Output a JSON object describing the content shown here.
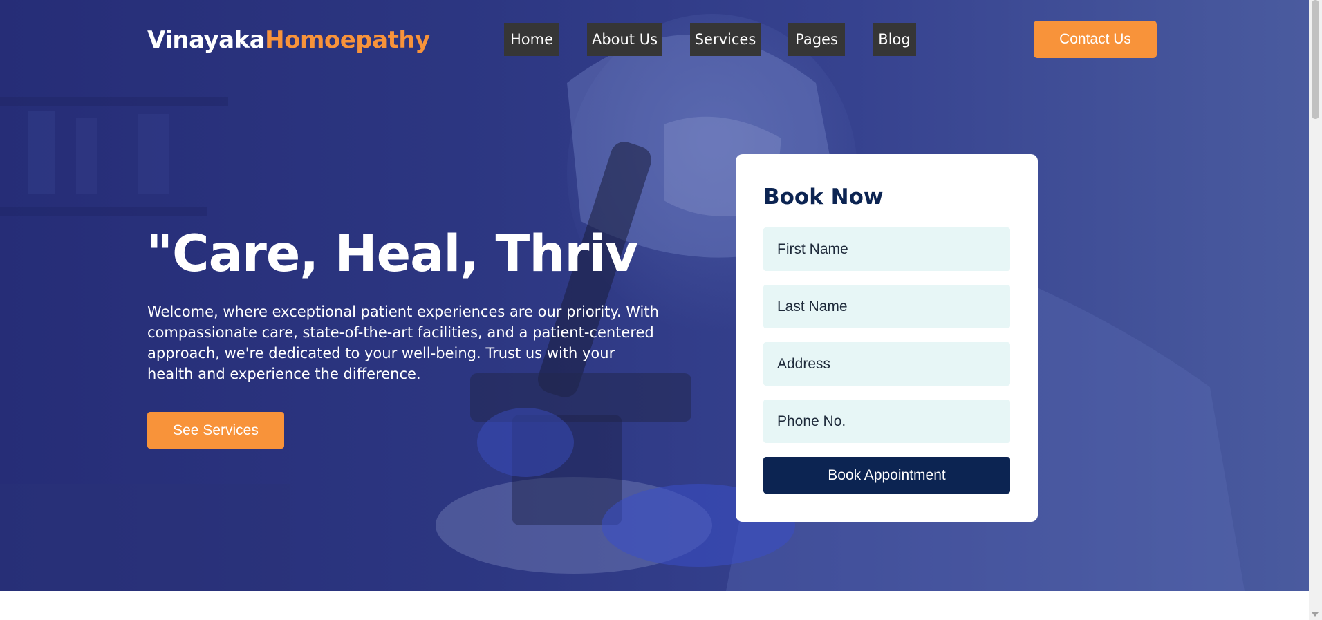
{
  "header": {
    "logo": {
      "part1": "Vinayaka",
      "part2": "Homoepathy"
    },
    "nav": [
      {
        "label": "Home"
      },
      {
        "label": "About Us"
      },
      {
        "label": "Services"
      },
      {
        "label": "Pages"
      },
      {
        "label": "Blog"
      }
    ],
    "contact_label": "Contact Us"
  },
  "hero": {
    "title": "\"Care, Heal, Thriv",
    "description": "Welcome, where exceptional patient experiences are our priority. With compassionate care, state-of-the-art facilities, and a patient-centered approach, we're dedicated to your well-being. Trust us with your health and experience the difference.",
    "cta_label": "See Services"
  },
  "booking": {
    "title": "Book Now",
    "fields": {
      "first_name": "First Name",
      "last_name": "Last Name",
      "address": "Address",
      "phone": "Phone No."
    },
    "submit_label": "Book Appointment"
  },
  "colors": {
    "accent": "#f8933a",
    "navy": "#0c2452",
    "hero_overlay": "#2c3681",
    "field_bg": "#e7f6f6",
    "nav_bg": "#363636"
  }
}
